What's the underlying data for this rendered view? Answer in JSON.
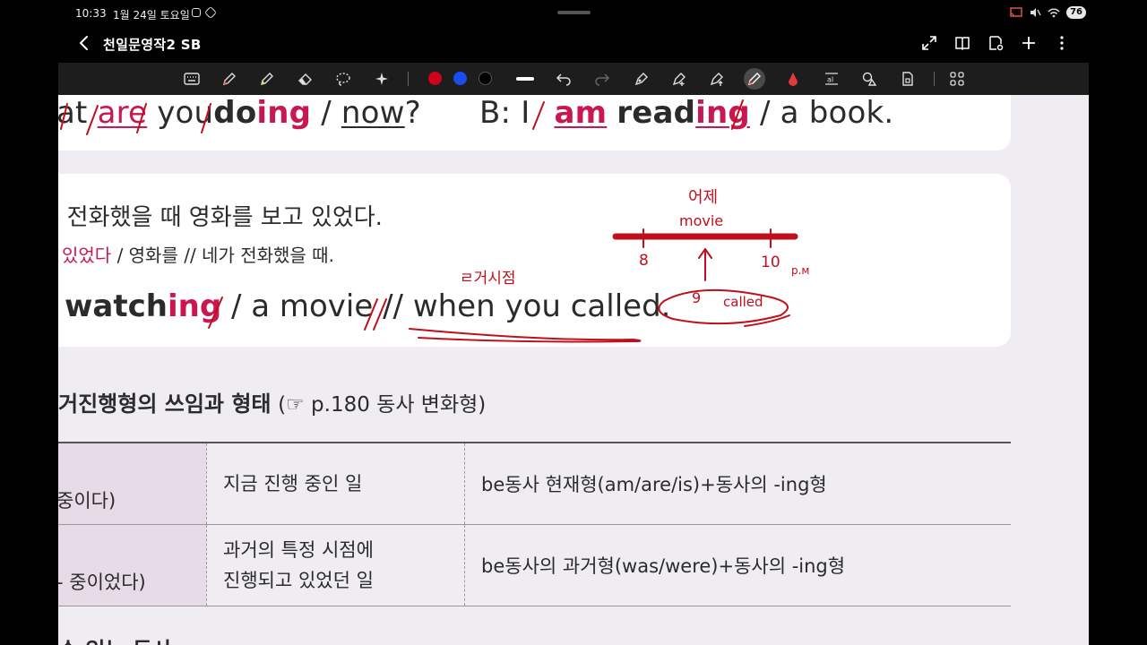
{
  "status_bar": {
    "time": "10:33",
    "date": "1월 24일 토요일",
    "battery": "76"
  },
  "title_bar": {
    "title": "천일문영작2 SB"
  },
  "toolbar": {
    "colors": [
      "#d0021b",
      "#1a4cf0",
      "#000000"
    ],
    "active_tool": "highlighter-pen"
  },
  "page": {
    "example1": {
      "a_fragment": "at",
      "are": "are",
      "you": "you",
      "do": "do",
      "do_ing": "ing",
      "slash": "/",
      "now": "now",
      "q": "?",
      "b_label": "B: I",
      "am": "am",
      "read": "read",
      "read_ing": "ing",
      "rest": "/ a book."
    },
    "example2": {
      "korean_sentence": "- 전화했을 때 영화를 보고 있었다.",
      "chunk_highlight": "있었다",
      "chunk_rest": "/ 영화를 // 네가 전화했을 때.",
      "en_watch": "watch",
      "en_ing": "ing",
      "en_middle": "/ a movie //",
      "en_when": "when you called."
    },
    "section": {
      "title": "거진행형의 쓰임과 형태",
      "reference": "(☞ p.180 동사 변화형)"
    },
    "table": {
      "rows": [
        {
          "label": "중이다)",
          "meaning": [
            "지금 진행 중인 일"
          ],
          "form": "be동사 현재형(am/are/is)+동사의 -ing형"
        },
        {
          "label": "- 중이었다)",
          "meaning": [
            "과거의 특정 시점에",
            "진행되고 있었던 일"
          ],
          "form": "be동사의 과거형(was/were)+동사의 -ing형"
        }
      ]
    },
    "bottom_fragment": "수 있는 동사"
  },
  "handwriting": {
    "yesterday": "어제",
    "movie": "movie",
    "start": "8",
    "end": "10",
    "pm": "p.м",
    "nine": "9",
    "called": "called",
    "note": "ㄹ거시점"
  }
}
